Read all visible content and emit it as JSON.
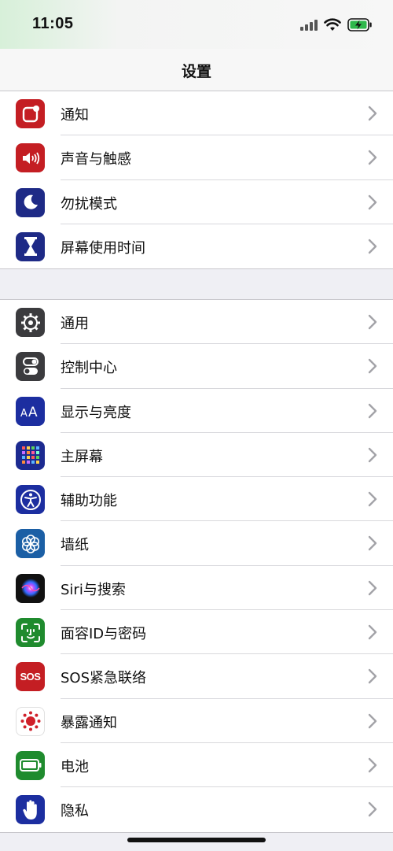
{
  "status_bar": {
    "time": "11:05",
    "battery_icon": "battery-charging-icon",
    "signal_icon": "signal-icon",
    "wifi_icon": "wifi-icon"
  },
  "nav": {
    "title": "设置"
  },
  "group1": [
    {
      "name": "notifications",
      "label": "通知",
      "icon": "notifications-icon",
      "color": "#c41e23"
    },
    {
      "name": "sounds-haptics",
      "label": "声音与触感",
      "icon": "speaker-icon",
      "color": "#c41e23"
    },
    {
      "name": "do-not-disturb",
      "label": "勿扰模式",
      "icon": "moon-icon",
      "color": "#1e2a86"
    },
    {
      "name": "screen-time",
      "label": "屏幕使用时间",
      "icon": "hourglass-icon",
      "color": "#1e2a86"
    }
  ],
  "group2": [
    {
      "name": "general",
      "label": "通用",
      "icon": "gear-icon",
      "color": "#3b3b3e"
    },
    {
      "name": "control-center",
      "label": "控制中心",
      "icon": "toggles-icon",
      "color": "#3b3b3e"
    },
    {
      "name": "display-brightness",
      "label": "显示与亮度",
      "icon": "text-size-icon",
      "color": "#1c2ea0"
    },
    {
      "name": "home-screen",
      "label": "主屏幕",
      "icon": "app-grid-icon",
      "color": "#1c2a90"
    },
    {
      "name": "accessibility",
      "label": "辅助功能",
      "icon": "accessibility-icon",
      "color": "#1c2ea0"
    },
    {
      "name": "wallpaper",
      "label": "墙纸",
      "icon": "flower-icon",
      "color": "#1b5fa5"
    },
    {
      "name": "siri-search",
      "label": "Siri与搜索",
      "icon": "siri-icon",
      "color": "#111111"
    },
    {
      "name": "face-id-passcode",
      "label": "面容ID与密码",
      "icon": "face-id-icon",
      "color": "#1f8b2e"
    },
    {
      "name": "emergency-sos",
      "label": "SOS紧急联络",
      "icon": "sos-icon",
      "color": "#c41e23",
      "icon_text": "SOS"
    },
    {
      "name": "exposure-notifications",
      "label": "暴露通知",
      "icon": "exposure-icon",
      "color": "#ffffff"
    },
    {
      "name": "battery",
      "label": "电池",
      "icon": "battery-icon",
      "color": "#1f8b2e"
    },
    {
      "name": "privacy",
      "label": "隐私",
      "icon": "hand-icon",
      "color": "#1c2ea0"
    }
  ]
}
